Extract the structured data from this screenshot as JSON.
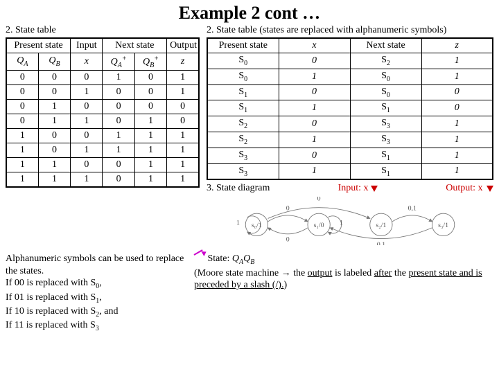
{
  "title": "Example 2 cont …",
  "left": {
    "caption": "2. State table",
    "headers": {
      "present": "Present state",
      "input": "Input",
      "next": "Next state",
      "output": "Output",
      "qa": "QA",
      "qb": "QB",
      "x": "x",
      "qap": "QA+",
      "qbp": "QB+",
      "z": "z"
    },
    "rows": [
      [
        "0",
        "0",
        "0",
        "1",
        "0",
        "1"
      ],
      [
        "0",
        "0",
        "1",
        "0",
        "0",
        "1"
      ],
      [
        "0",
        "1",
        "0",
        "0",
        "0",
        "0"
      ],
      [
        "0",
        "1",
        "1",
        "0",
        "1",
        "0"
      ],
      [
        "1",
        "0",
        "0",
        "1",
        "1",
        "1"
      ],
      [
        "1",
        "0",
        "1",
        "1",
        "1",
        "1"
      ],
      [
        "1",
        "1",
        "0",
        "0",
        "1",
        "1"
      ],
      [
        "1",
        "1",
        "1",
        "0",
        "1",
        "1"
      ]
    ]
  },
  "right": {
    "caption": "2. State table (states are replaced with alphanumeric symbols)",
    "headers": {
      "present": "Present state",
      "x": "x",
      "next": "Next state",
      "z": "z"
    },
    "rows": [
      [
        "S0",
        "0",
        "S2",
        "1"
      ],
      [
        "S0",
        "1",
        "S0",
        "1"
      ],
      [
        "S1",
        "0",
        "S0",
        "0"
      ],
      [
        "S1",
        "1",
        "S1",
        "0"
      ],
      [
        "S2",
        "0",
        "S3",
        "1"
      ],
      [
        "S2",
        "1",
        "S3",
        "1"
      ],
      [
        "S3",
        "0",
        "S1",
        "1"
      ],
      [
        "S3",
        "1",
        "S1",
        "1"
      ]
    ],
    "sd_label": "3. State diagram",
    "input_label": "Input: x",
    "output_label": "Output: x",
    "state_label_pre": "State: ",
    "state_label_val": "QAQB",
    "moore": "(Moore state machine → the output is labeled after the present state and is preceded by a slash (/).)"
  },
  "footer": {
    "p_intro": "Alphanumeric symbols can be used to replace the states.",
    "p_l1": "If 00 is replaced with S0,",
    "p_l2": "If 01 is replaced with S1,",
    "p_l3": "If 10 is replaced with S2, and",
    "p_l4": "If 11 is replaced with S3"
  },
  "chart_data": {
    "type": "table",
    "left_table": {
      "columns": [
        "QA",
        "QB",
        "x",
        "QA+",
        "QB+",
        "z"
      ],
      "rows": [
        [
          0,
          0,
          0,
          1,
          0,
          1
        ],
        [
          0,
          0,
          1,
          0,
          0,
          1
        ],
        [
          0,
          1,
          0,
          0,
          0,
          0
        ],
        [
          0,
          1,
          1,
          0,
          1,
          0
        ],
        [
          1,
          0,
          0,
          1,
          1,
          1
        ],
        [
          1,
          0,
          1,
          1,
          1,
          1
        ],
        [
          1,
          1,
          0,
          0,
          1,
          1
        ],
        [
          1,
          1,
          1,
          0,
          1,
          1
        ]
      ]
    },
    "right_table": {
      "columns": [
        "Present state",
        "x",
        "Next state",
        "z"
      ],
      "rows": [
        [
          "S0",
          0,
          "S2",
          1
        ],
        [
          "S0",
          1,
          "S0",
          1
        ],
        [
          "S1",
          0,
          "S0",
          0
        ],
        [
          "S1",
          1,
          "S1",
          0
        ],
        [
          "S2",
          0,
          "S3",
          1
        ],
        [
          "S2",
          1,
          "S3",
          1
        ],
        [
          "S3",
          0,
          "S1",
          1
        ],
        [
          "S3",
          1,
          "S1",
          1
        ]
      ]
    },
    "state_diagram": {
      "states": [
        {
          "name": "S0",
          "output": 1
        },
        {
          "name": "S1",
          "output": 0
        },
        {
          "name": "S2",
          "output": 1
        },
        {
          "name": "S3",
          "output": 1
        }
      ],
      "transitions": [
        {
          "from": "S0",
          "to": "S2",
          "on": 0
        },
        {
          "from": "S0",
          "to": "S0",
          "on": 1
        },
        {
          "from": "S1",
          "to": "S0",
          "on": 0
        },
        {
          "from": "S1",
          "to": "S1",
          "on": 1
        },
        {
          "from": "S2",
          "to": "S3",
          "on": 0
        },
        {
          "from": "S2",
          "to": "S3",
          "on": 1
        },
        {
          "from": "S3",
          "to": "S1",
          "on": 0
        },
        {
          "from": "S3",
          "to": "S1",
          "on": 1
        }
      ]
    }
  }
}
